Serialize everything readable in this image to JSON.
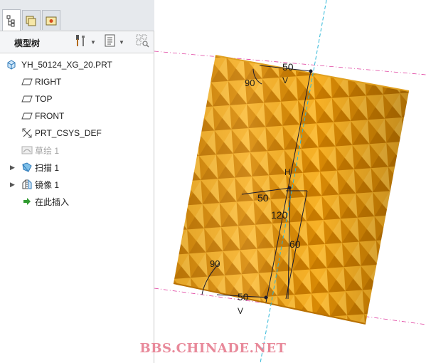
{
  "left_panel": {
    "tabs": [
      {
        "name": "model-tree-tab",
        "icon": "tree-icon"
      },
      {
        "name": "folder-browser-tab",
        "icon": "folder-icon"
      },
      {
        "name": "favorites-tab",
        "icon": "favorites-icon"
      }
    ],
    "header": {
      "title": "模型树",
      "settings_icon": "tools-icon",
      "show_icon": "list-icon",
      "filter_icon": "filter-icon"
    },
    "tree": {
      "root": "YH_50124_XG_20.PRT",
      "items": [
        {
          "label": "RIGHT",
          "icon": "datum-plane-icon"
        },
        {
          "label": "TOP",
          "icon": "datum-plane-icon"
        },
        {
          "label": "FRONT",
          "icon": "datum-plane-icon"
        },
        {
          "label": "PRT_CSYS_DEF",
          "icon": "csys-icon"
        },
        {
          "label": "草绘 1",
          "icon": "sketch-icon",
          "suppressed": true
        },
        {
          "label": "扫描 1",
          "icon": "sweep-icon",
          "expandable": true
        },
        {
          "label": "镜像 1",
          "icon": "mirror-icon",
          "expandable": true
        },
        {
          "label": "在此插入",
          "icon": "insert-arrow-icon"
        }
      ]
    }
  },
  "viewport": {
    "dimensions": {
      "top_width": "50",
      "top_angle": "90",
      "top_constraint": "V",
      "mid_width": "50",
      "height": "120",
      "half_height": "60",
      "bottom_angle": "90",
      "bottom_width": "50",
      "bottom_constraint": "V",
      "horizontal_constraint": "H"
    },
    "colors": {
      "part_orange": "#f0a010",
      "part_dark": "#c97c00",
      "dimension": "#1a1a2e",
      "datum_plane": "#e040a0",
      "axis": "#30b8d8"
    }
  },
  "watermark": "BBS.CHINADE.NET"
}
